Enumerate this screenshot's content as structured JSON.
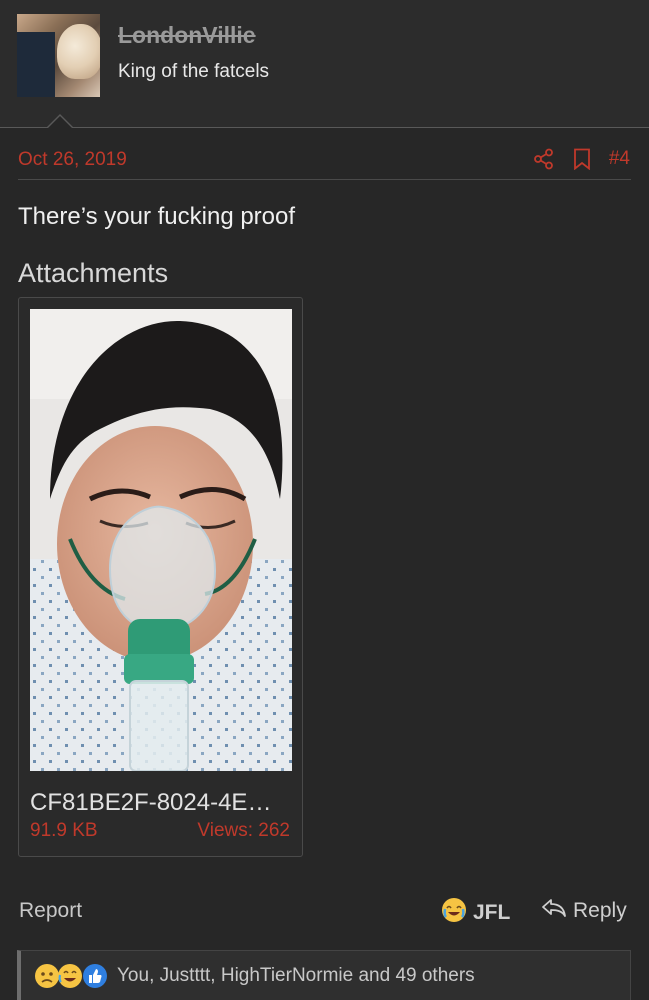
{
  "user": {
    "name": "LondonVillie",
    "title": "King of the fatcels"
  },
  "post": {
    "date": "Oct 26, 2019",
    "number": "#4",
    "text": "There’s your fucking proof"
  },
  "attachments": {
    "title": "Attachments",
    "items": [
      {
        "name": "CF81BE2F-8024-4E…",
        "size": "91.9 KB",
        "views": "Views: 262"
      }
    ]
  },
  "footer": {
    "report_label": "Report",
    "jfl_label": "JFL",
    "reply_label": "Reply",
    "reactions_text": "You, Justttt, HighTierNormie and 49 others"
  },
  "colors": {
    "background": "#272727",
    "accent": "#c0392b",
    "text": "#e6e6e6",
    "muted": "#9a9a9a"
  },
  "icons": [
    "avatar-image",
    "share-icon",
    "bookmark-icon",
    "jfl-emoji-icon",
    "reply-icon",
    "sad-emoji-icon",
    "cry-laugh-emoji-icon",
    "like-icon"
  ]
}
